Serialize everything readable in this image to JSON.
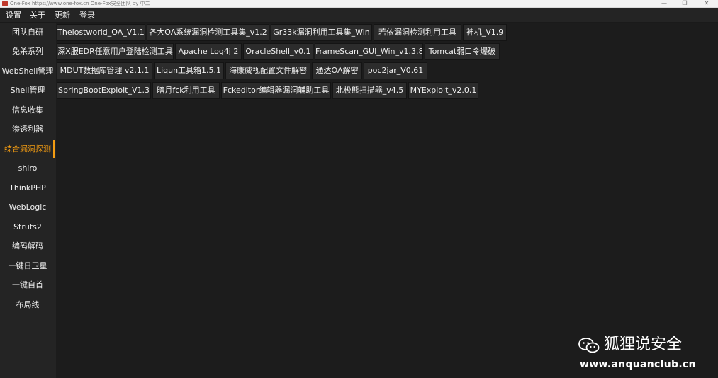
{
  "window": {
    "title": "One-Fox https://www.one-fox.cn One-Fox安全团队  by 中二",
    "minimize_glyph": "—",
    "maximize_glyph": "❐",
    "close_glyph": "✕"
  },
  "menu": [
    "设置",
    "关于",
    "更新",
    "登录"
  ],
  "sidebar": {
    "items": [
      "团队自研",
      "免杀系列",
      "WebShell管理",
      "Shell管理",
      "信息收集",
      "渗透利器",
      "综合漏洞探测",
      "shiro",
      "ThinkPHP",
      "WebLogic",
      "Struts2",
      "编码解码",
      "一键日卫星",
      "一键自首",
      "布局线"
    ],
    "active_index": 6,
    "accent_color": "#f39c12"
  },
  "tools": {
    "rows": [
      [
        "Thelostworld_OA_V1.1",
        "各大OA系统漏洞检测工具集_v1.2",
        "Gr33k漏洞利用工具集_Win",
        "若依漏洞检测利用工具",
        "神机_V1.9"
      ],
      [
        "深X服EDR任意用户登陆检测工具",
        "Apache Log4j 2",
        "OracleShell_v0.1",
        "FrameScan_GUI_Win_v1.3.8",
        "Tomcat弱口令爆破"
      ],
      [
        "MDUT数据库管理 v2.1.1",
        "Liqun工具箱1.5.1",
        "海康威视配置文件解密",
        "通达OA解密",
        "poc2jar_V0.61"
      ],
      [
        "SpringBootExploit_V1.3",
        "暗月fck利用工具",
        "Fckeditor编辑器漏洞辅助工具",
        "北极熊扫描器_v4.5",
        "MYExploit_v2.0.1"
      ]
    ]
  },
  "watermark": {
    "icon": "wechat-icon",
    "text": "狐狸说安全",
    "url": "www.anquanclub.cn"
  }
}
